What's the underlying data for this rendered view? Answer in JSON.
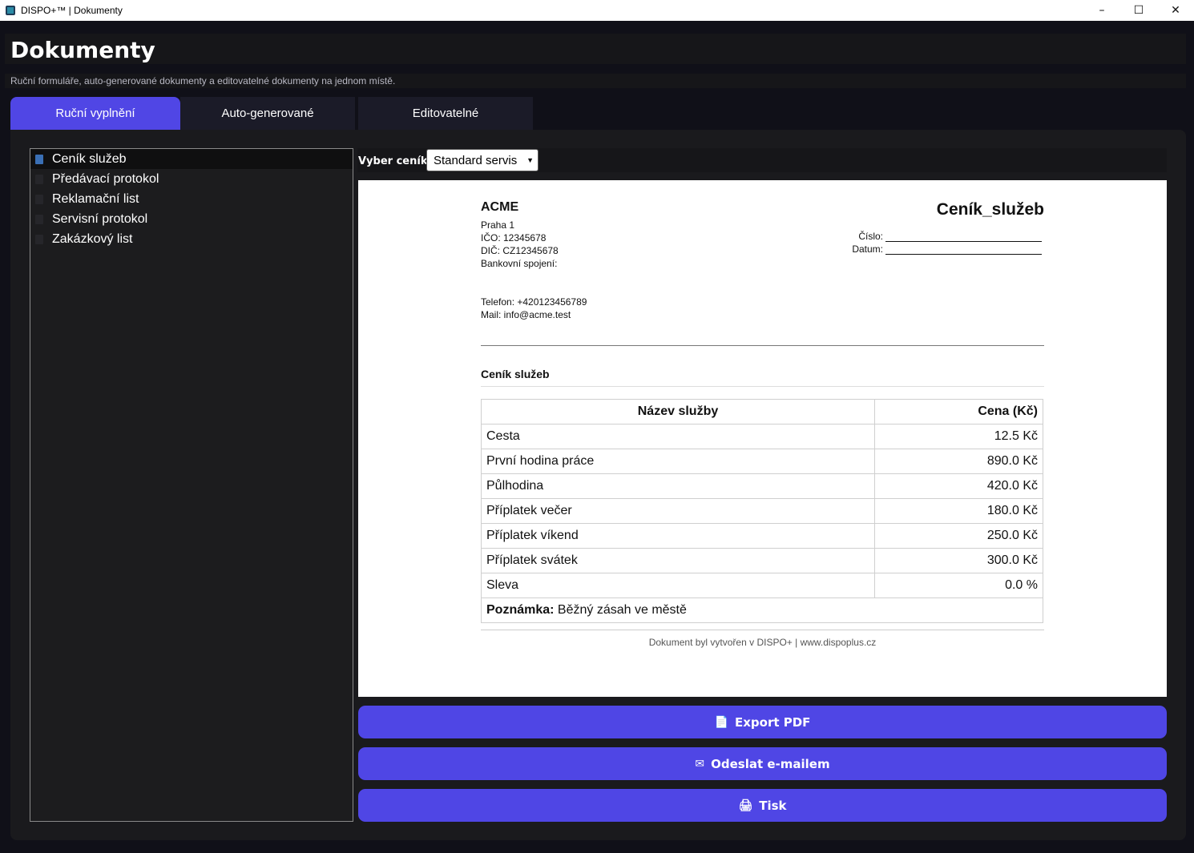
{
  "window": {
    "title": "DISPO+™ | Dokumenty",
    "minimize": "–",
    "maximize": "☐",
    "close": "✕"
  },
  "header": {
    "title": "Dokumenty",
    "subtitle": "Ruční formuláře, auto-generované dokumenty a editovatelné dokumenty na jednom místě."
  },
  "tabs": [
    {
      "label": "Ruční vyplnění",
      "active": true
    },
    {
      "label": "Auto-generované",
      "active": false
    },
    {
      "label": "Editovatelné",
      "active": false
    }
  ],
  "sidebar": {
    "items": [
      {
        "label": "Ceník služeb",
        "selected": true
      },
      {
        "label": "Předávací protokol",
        "selected": false
      },
      {
        "label": "Reklamační list",
        "selected": false
      },
      {
        "label": "Servisní protokol",
        "selected": false
      },
      {
        "label": "Zakázkový list",
        "selected": false
      }
    ]
  },
  "selector": {
    "label": "Vyber ceník:",
    "value": "Standard servis"
  },
  "document": {
    "company": "ACME",
    "address": "Praha 1",
    "ico": "IČO: 12345678",
    "dic": "DIČ: CZ12345678",
    "bank": "Bankovní spojení:",
    "phone": "Telefon: +420123456789",
    "mail": "Mail: info@acme.test",
    "title": "Ceník_služeb",
    "number_label": "Číslo:",
    "date_label": "Datum:",
    "section": "Ceník služeb",
    "table": {
      "headers": [
        "Název služby",
        "Cena (Kč)"
      ],
      "rows": [
        [
          "Cesta",
          "12.5 Kč"
        ],
        [
          "První hodina práce",
          "890.0 Kč"
        ],
        [
          "Půlhodina",
          "420.0 Kč"
        ],
        [
          "Příplatek večer",
          "180.0 Kč"
        ],
        [
          "Příplatek víkend",
          "250.0 Kč"
        ],
        [
          "Příplatek svátek",
          "300.0 Kč"
        ],
        [
          "Sleva",
          "0.0 %"
        ]
      ],
      "note_label": "Poznámka:",
      "note_value": " Běžný zásah ve městě"
    },
    "footer": "Dokument byl vytvořen v DISPO+ | www.dispoplus.cz"
  },
  "actions": {
    "export_pdf": "Export PDF",
    "send_email": "Odeslat e-mailem",
    "print": "Tisk"
  },
  "icons": {
    "export": "📄",
    "email": "✉",
    "print": "🖨"
  },
  "colors": {
    "accent": "#4f46e5",
    "background": "#101018",
    "panel": "#1a1a1d"
  }
}
